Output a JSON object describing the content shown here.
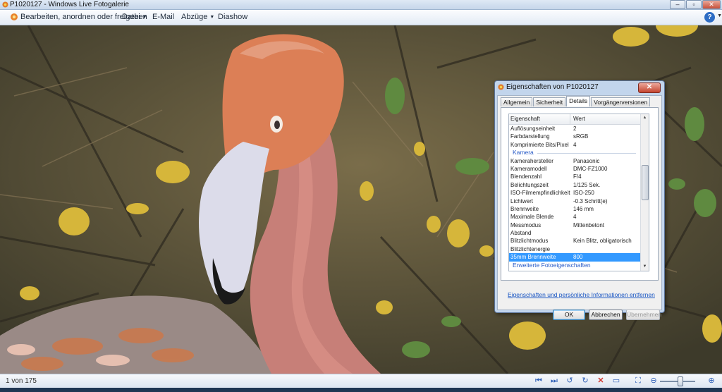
{
  "window": {
    "title": "P1020127 - Windows Live Fotogalerie"
  },
  "menubar": {
    "edit_share": "Bearbeiten, anordnen oder freigeben",
    "file": "Datei",
    "email": "E-Mail",
    "prints": "Abzüge",
    "slideshow": "Diashow"
  },
  "status": {
    "position": "1 von 175"
  },
  "dialog": {
    "title": "Eigenschaften von P1020127",
    "tabs": [
      "Allgemein",
      "Sicherheit",
      "Details",
      "Vorgängerversionen"
    ],
    "active_tab": "Details",
    "columns": {
      "property": "Eigenschaft",
      "value": "Wert"
    },
    "rows": [
      {
        "p": "Auflösungseinheit",
        "v": "2"
      },
      {
        "p": "Farbdarstellung",
        "v": "sRGB"
      },
      {
        "p": "Komprimierte Bits/Pixel",
        "v": "4"
      },
      {
        "p": "Kamera",
        "v": "",
        "group": true
      },
      {
        "p": "Kamerahersteller",
        "v": "Panasonic"
      },
      {
        "p": "Kameramodell",
        "v": "DMC-FZ1000"
      },
      {
        "p": "Blendenzahl",
        "v": "F/4"
      },
      {
        "p": "Belichtungszeit",
        "v": "1/125 Sek."
      },
      {
        "p": "ISO-Filmempfindlichkeit",
        "v": "ISO-250"
      },
      {
        "p": "Lichtwert",
        "v": "-0.3 Schritt(e)"
      },
      {
        "p": "Brennweite",
        "v": "146 mm"
      },
      {
        "p": "Maximale Blende",
        "v": "4"
      },
      {
        "p": "Messmodus",
        "v": "Mittenbetont"
      },
      {
        "p": "Abstand",
        "v": ""
      },
      {
        "p": "Blitzlichtmodus",
        "v": "Kein Blitz, obligatorisch"
      },
      {
        "p": "Blitzlichtenergie",
        "v": ""
      },
      {
        "p": "35mm Brennweite",
        "v": "800",
        "selected": true
      },
      {
        "p": "Erweiterte Fotoeigenschaften",
        "v": "",
        "partial": true
      }
    ],
    "remove_link": "Eigenschaften und persönliche Informationen entfernen",
    "buttons": {
      "ok": "OK",
      "cancel": "Abbrechen",
      "apply": "Übernehmen"
    }
  }
}
